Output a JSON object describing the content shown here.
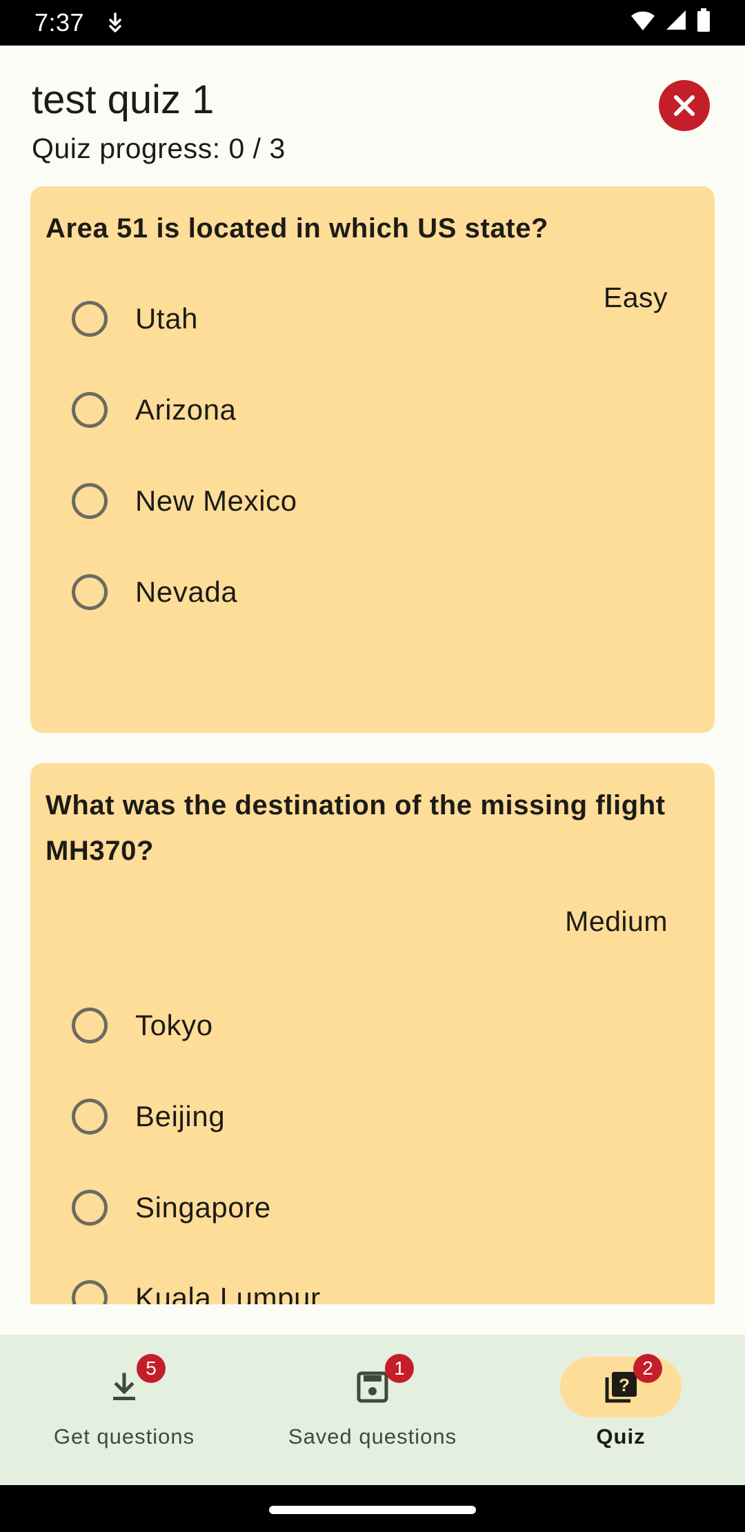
{
  "status_bar": {
    "time": "7:37",
    "icons": [
      "download-notification-icon",
      "wifi-icon",
      "signal-icon",
      "battery-icon"
    ]
  },
  "header": {
    "title": "test quiz 1",
    "progress": "Quiz progress: 0 / 3",
    "close_icon": "close-icon"
  },
  "questions": [
    {
      "text": "Area 51 is located in which US state?",
      "difficulty": "Easy",
      "options": [
        "Utah",
        "Arizona",
        "New Mexico",
        "Nevada"
      ]
    },
    {
      "text": "What was the destination of the missing flight MH370?",
      "difficulty": "Medium",
      "options": [
        "Tokyo",
        "Beijing",
        "Singapore",
        "Kuala Lumpur"
      ]
    }
  ],
  "bottom_nav": [
    {
      "label": "Get questions",
      "icon": "download-icon",
      "badge": "5",
      "active": false
    },
    {
      "label": "Saved questions",
      "icon": "save-icon",
      "badge": "1",
      "active": false
    },
    {
      "label": "Quiz",
      "icon": "quiz-icon",
      "badge": "2",
      "active": true
    }
  ],
  "colors": {
    "card": "#fedd98",
    "accent_red": "#c41e2a",
    "nav_background": "#e5efe0",
    "page_background": "#fbfcf6"
  }
}
